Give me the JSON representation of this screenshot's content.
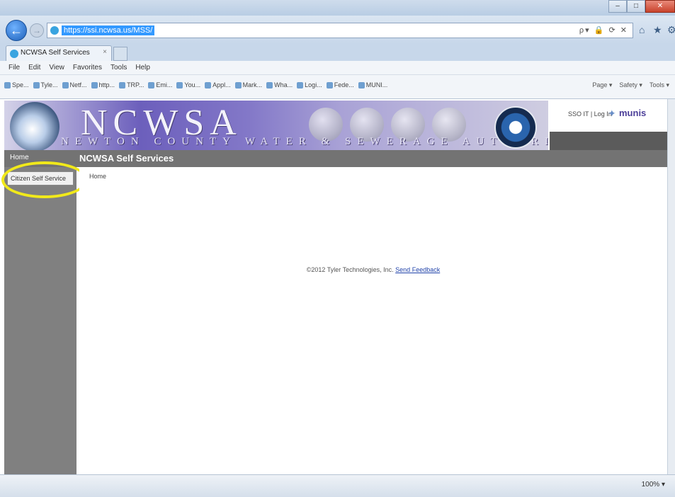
{
  "browser": {
    "url": "https://ssi.ncwsa.us/MSS/",
    "address_tools": "ρ▾ 🔒 ⟳ ✕",
    "tab_title": "NCWSA Self Services",
    "menu": [
      "File",
      "Edit",
      "View",
      "Favorites",
      "Tools",
      "Help"
    ],
    "favorites": [
      "Spe...",
      "Tyle...",
      "Netf...",
      "http...",
      "TRP...",
      "Emi...",
      "You...",
      "Appl...",
      "Mark...",
      "Wha...",
      "Logi...",
      "Fede...",
      "MUNI..."
    ],
    "command_bar": [
      "Page ▾",
      "Safety ▾",
      "Tools ▾"
    ],
    "zoom": "100% ▾"
  },
  "banner": {
    "title": "NCWSA",
    "subtitle": "NEWTON COUNTY WATER & SEWERAGE AUTHORITY",
    "user_links": "SSO IT | Log In",
    "logo_text": "munis"
  },
  "header": {
    "home_label": "Home",
    "section_title": "NCWSA Self Services"
  },
  "sidebar": {
    "items": [
      "Citizen Self Service"
    ]
  },
  "content": {
    "breadcrumb": "Home",
    "footer_copyright": "©2012 Tyler Technologies, Inc.",
    "footer_link": "Send Feedback"
  },
  "colors": {
    "highlight": "#f1e91a",
    "header_gray": "#737373",
    "sidebar_gray": "#808080"
  }
}
